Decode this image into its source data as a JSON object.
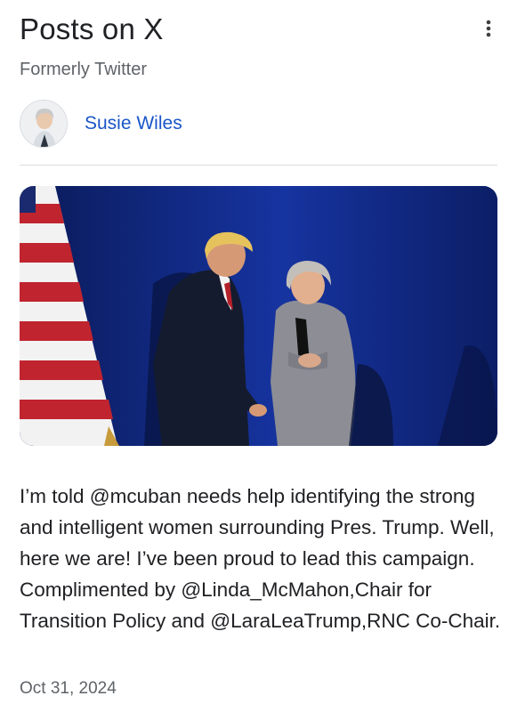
{
  "header": {
    "title": "Posts on X",
    "subtitle": "Formerly Twitter",
    "menu_icon": "more-vert-icon"
  },
  "author": {
    "name": "Susie Wiles",
    "avatar_icon": "avatar-photo"
  },
  "post": {
    "image_icon": "post-photo",
    "text": "I’m told @mcuban needs help identifying the strong and intelligent women surrounding Pres. Trump. Well, here we are! I’ve been proud to lead this campaign. Complimented by @Linda_McMahon,Chair for Transition Policy and @LaraLeaTrump,RNC Co-Chair.",
    "date": "Oct 31, 2024"
  },
  "colors": {
    "link": "#1a56c7",
    "secondary_text": "#5f6368",
    "divider": "#dadce0",
    "photo_background": "#0e1f63"
  }
}
